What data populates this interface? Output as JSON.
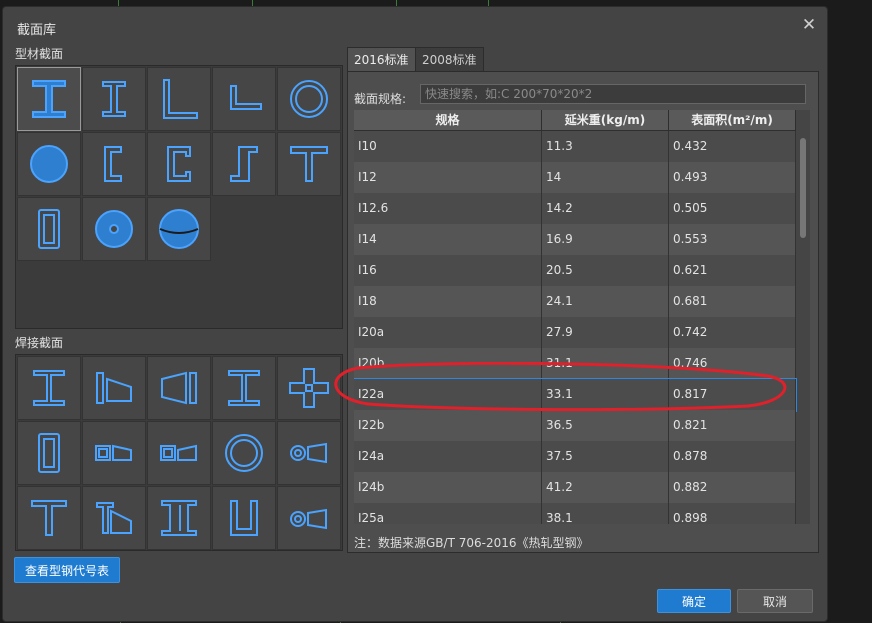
{
  "dialog": {
    "title": "截面库",
    "close_icon": "close-icon"
  },
  "left": {
    "profile_label": "型材截面",
    "weld_label": "焊接截面",
    "view_codes_button": "查看型钢代号表",
    "profile_icons": [
      "i-beam-icon",
      "i-beam-narrow-icon",
      "angle-icon",
      "angle-unequal-icon",
      "pipe-icon",
      "solid-round-icon",
      "channel-open-icon",
      "channel-icon",
      "z-section-icon",
      "t-section-icon",
      "rect-tube-icon",
      "hollow-round-icon",
      "sphere-icon"
    ],
    "weld_icons": [
      "welded-i-icon",
      "tapered-i-icon",
      "tapered-i-reverse-icon",
      "welded-h-icon",
      "cross-section-icon",
      "welded-box-icon",
      "tapered-box-icon",
      "tapered-box-reverse-icon",
      "welded-pipe-icon",
      "tapered-pipe-icon",
      "welded-t-icon",
      "tapered-t-icon",
      "double-i-icon",
      "u-section-icon",
      "tapered-pipe-small-icon"
    ]
  },
  "tabs": [
    {
      "label": "2016标准",
      "active": true
    },
    {
      "label": "2008标准",
      "active": false
    }
  ],
  "search": {
    "label": "截面规格:",
    "placeholder": "快速搜索，如:C 200*70*20*2"
  },
  "table": {
    "headers": [
      "规格",
      "延米重(kg/m)",
      "表面积(m²/m)"
    ],
    "rows": [
      [
        "I10",
        "11.3",
        "0.432"
      ],
      [
        "I12",
        "14",
        "0.493"
      ],
      [
        "I12.6",
        "14.2",
        "0.505"
      ],
      [
        "I14",
        "16.9",
        "0.553"
      ],
      [
        "I16",
        "20.5",
        "0.621"
      ],
      [
        "I18",
        "24.1",
        "0.681"
      ],
      [
        "I20a",
        "27.9",
        "0.742"
      ],
      [
        "I20b",
        "31.1",
        "0.746"
      ],
      [
        "I22a",
        "33.1",
        "0.817"
      ],
      [
        "I22b",
        "36.5",
        "0.821"
      ],
      [
        "I24a",
        "37.5",
        "0.878"
      ],
      [
        "I24b",
        "41.2",
        "0.882"
      ],
      [
        "I25a",
        "38.1",
        "0.898"
      ]
    ],
    "selected_row": 8
  },
  "note": "注：数据来源GB/T 706-2016《热轧型钢》",
  "footer": {
    "ok": "确定",
    "cancel": "取消"
  },
  "colors": {
    "accent": "#1e7bd0",
    "icon_stroke": "#4aa3ff",
    "annotation": "#e0202a"
  }
}
